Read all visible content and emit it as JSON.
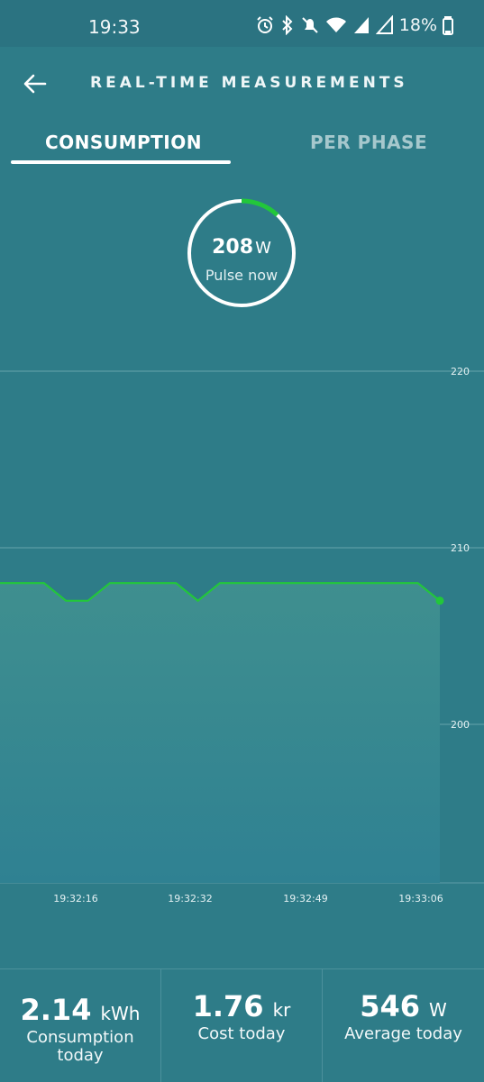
{
  "status_bar": {
    "time": "19:33",
    "battery": "18%"
  },
  "header": {
    "title": "REAL-TIME MEASUREMENTS"
  },
  "tabs": [
    {
      "label": "CONSUMPTION",
      "active": true
    },
    {
      "label": "PER PHASE",
      "active": false
    }
  ],
  "gauge": {
    "value": "208",
    "unit": "W",
    "label": "Pulse now",
    "fill_fraction": 0.12,
    "accent": "#22c73a"
  },
  "chart_data": {
    "type": "area",
    "x_labels": [
      "19:32:16",
      "19:32:32",
      "19:32:49",
      "19:33:06"
    ],
    "y_ticks": [
      "220",
      "210",
      "200"
    ],
    "ylim": [
      200,
      220
    ],
    "series": [
      {
        "values": [
          208,
          208,
          208,
          207,
          207,
          208,
          208,
          208,
          208,
          207,
          208,
          208,
          208,
          208,
          208,
          208,
          208,
          208,
          208,
          208,
          207
        ]
      }
    ],
    "line_color": "#22c73a"
  },
  "stats": [
    {
      "value": "2.14",
      "unit": "kWh",
      "label": "Consumption today"
    },
    {
      "value": "1.76",
      "unit": "kr",
      "label": "Cost today"
    },
    {
      "value": "546",
      "unit": "W",
      "label": "Average today"
    }
  ]
}
